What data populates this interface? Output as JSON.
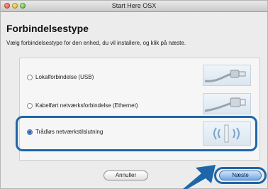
{
  "window": {
    "title": "Start Here OSX"
  },
  "heading": "Forbindelsestype",
  "subtitle": "Vælg forbindelsestype for den enhed, du vil installere, og klik på næste.",
  "options": [
    {
      "label": "Lokalforbindelse (USB)",
      "selected": false,
      "icon": "usb-cable-icon"
    },
    {
      "label": "Kabelført netværksforbindelse (Ethernet)",
      "selected": false,
      "icon": "ethernet-cable-icon"
    },
    {
      "label": "Trådløs netværkstilslutning",
      "selected": true,
      "icon": "wireless-signal-icon"
    }
  ],
  "buttons": {
    "cancel": "Annuller",
    "next": "Næste"
  },
  "colors": {
    "highlight": "#1f66a8",
    "default_button": "#6fa9ea"
  }
}
